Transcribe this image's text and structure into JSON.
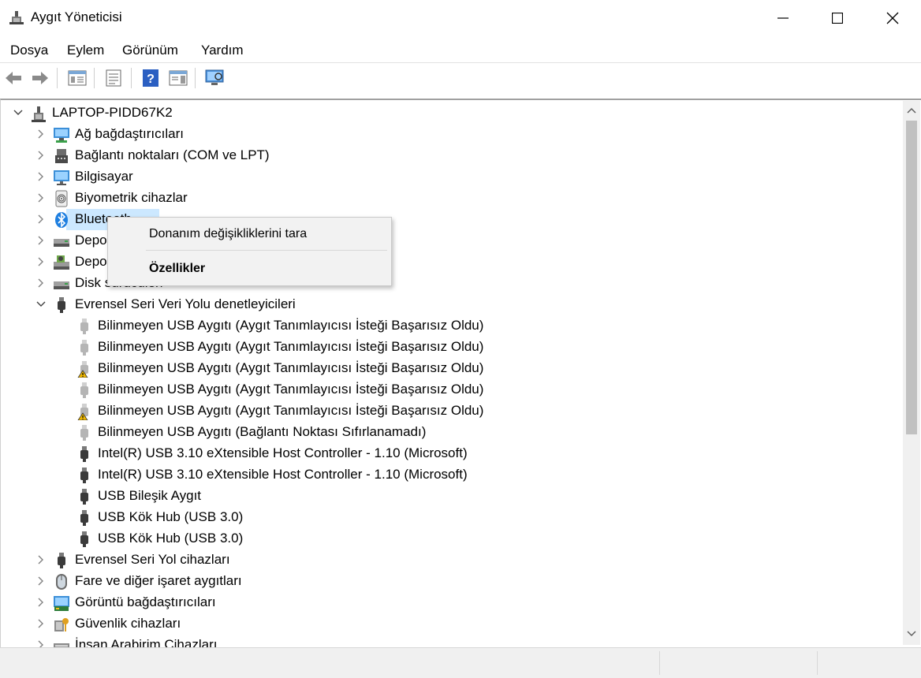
{
  "window": {
    "title": "Aygıt Yöneticisi",
    "minimize_glyph": "—",
    "maximize_glyph": "☐",
    "close_glyph": "✕"
  },
  "menu": {
    "file": "Dosya",
    "action": "Eylem",
    "view": "Görünüm",
    "help": "Yardım"
  },
  "tree": {
    "root": "LAPTOP-PIDD67K2",
    "categories": [
      {
        "label": "Ağ bağdaştırıcıları",
        "icon": "network-icon"
      },
      {
        "label": "Bağlantı noktaları (COM ve LPT)",
        "icon": "port-icon"
      },
      {
        "label": "Bilgisayar",
        "icon": "computer-icon"
      },
      {
        "label": "Biyometrik cihazlar",
        "icon": "fingerprint-icon"
      },
      {
        "label": "Bluetooth",
        "icon": "bluetooth-icon"
      },
      {
        "label": "Depolama denetleyicileri",
        "icon": "storage-icon"
      },
      {
        "label": "Depolama birimleri",
        "icon": "storage-volume-icon"
      },
      {
        "label": "Disk sürücüleri",
        "icon": "disk-icon"
      },
      {
        "label": "Evrensel Seri Veri Yolu denetleyicileri",
        "icon": "usb-icon"
      }
    ],
    "usb_children": [
      {
        "label": "Bilinmeyen USB Aygıtı (Aygıt Tanımlayıcısı İsteği Başarısız Oldu)",
        "warning": false
      },
      {
        "label": "Bilinmeyen USB Aygıtı (Aygıt Tanımlayıcısı İsteği Başarısız Oldu)",
        "warning": false
      },
      {
        "label": "Bilinmeyen USB Aygıtı (Aygıt Tanımlayıcısı İsteği Başarısız Oldu)",
        "warning": true
      },
      {
        "label": "Bilinmeyen USB Aygıtı (Aygıt Tanımlayıcısı İsteği Başarısız Oldu)",
        "warning": false
      },
      {
        "label": "Bilinmeyen USB Aygıtı (Aygıt Tanımlayıcısı İsteği Başarısız Oldu)",
        "warning": true
      },
      {
        "label": "Bilinmeyen USB Aygıtı (Bağlantı Noktası Sıfırlanamadı)",
        "warning": false
      },
      {
        "label": "Intel(R) USB 3.10 eXtensible Host Controller - 1.10 (Microsoft)",
        "warning": false
      },
      {
        "label": "Intel(R) USB 3.10 eXtensible Host Controller - 1.10 (Microsoft)",
        "warning": false
      },
      {
        "label": "USB Bileşik Aygıt",
        "warning": false
      },
      {
        "label": "USB Kök Hub (USB 3.0)",
        "warning": false
      },
      {
        "label": "USB Kök Hub (USB 3.0)",
        "warning": false
      }
    ],
    "after": [
      {
        "label": "Evrensel Seri Yol cihazları",
        "icon": "usb-icon"
      },
      {
        "label": "Fare ve diğer işaret aygıtları",
        "icon": "mouse-icon"
      },
      {
        "label": "Görüntü bağdaştırıcıları",
        "icon": "display-adapter-icon"
      },
      {
        "label": "Güvenlik cihazları",
        "icon": "security-key-icon"
      },
      {
        "label": "İnsan Arabirim Cihazları",
        "icon": "hid-icon"
      }
    ]
  },
  "context_menu": {
    "scan": "Donanım değişikliklerini tara",
    "properties": "Özellikler"
  },
  "colors": {
    "selection": "#cce8ff",
    "menu_bg": "#f2f2f2",
    "accent_blue": "#0078d7"
  }
}
